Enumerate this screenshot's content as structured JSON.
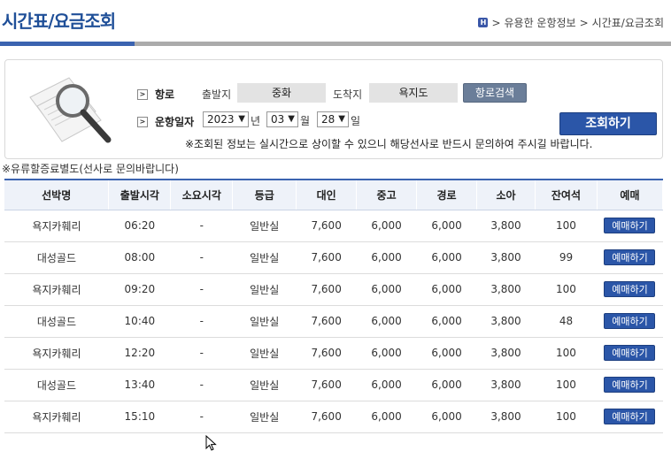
{
  "page_title": "시간표/요금조회",
  "breadcrumb": {
    "home_icon": "home-icon",
    "item1": "유용한 운항정보",
    "sep": ">",
    "item2": "시간표/요금조회"
  },
  "search": {
    "route_label": "항로",
    "departure_label": "출발지",
    "departure_value": "중화",
    "arrival_label": "도착지",
    "arrival_value": "욕지도",
    "route_search_button": "항로검색",
    "date_label": "운항일자",
    "year": "2023",
    "year_unit": "년",
    "month": "03",
    "month_unit": "월",
    "day": "28",
    "day_unit": "일",
    "lookup_button": "조회하기",
    "notice": "※조회된 정보는 실시간으로 상이할 수 있으니 해당선사로 반드시 문의하여 주시길 바랍니다."
  },
  "footnote": "※유류할증료별도(선사로 문의바랍니다)",
  "table": {
    "headers": [
      "선박명",
      "출발시각",
      "소요시각",
      "등급",
      "대인",
      "중고",
      "경로",
      "소아",
      "잔여석",
      "예매"
    ],
    "rows": [
      {
        "ship": "욕지카훼리",
        "time": "06:20",
        "duration": "-",
        "grade": "일반실",
        "adult": "7,600",
        "teen": "6,000",
        "senior": "6,000",
        "child": "3,800",
        "seats": "100",
        "book": "예매하기"
      },
      {
        "ship": "대성골드",
        "time": "08:00",
        "duration": "-",
        "grade": "일반실",
        "adult": "7,600",
        "teen": "6,000",
        "senior": "6,000",
        "child": "3,800",
        "seats": "99",
        "book": "예매하기"
      },
      {
        "ship": "욕지카훼리",
        "time": "09:20",
        "duration": "-",
        "grade": "일반실",
        "adult": "7,600",
        "teen": "6,000",
        "senior": "6,000",
        "child": "3,800",
        "seats": "100",
        "book": "예매하기"
      },
      {
        "ship": "대성골드",
        "time": "10:40",
        "duration": "-",
        "grade": "일반실",
        "adult": "7,600",
        "teen": "6,000",
        "senior": "6,000",
        "child": "3,800",
        "seats": "48",
        "book": "예매하기"
      },
      {
        "ship": "욕지카훼리",
        "time": "12:20",
        "duration": "-",
        "grade": "일반실",
        "adult": "7,600",
        "teen": "6,000",
        "senior": "6,000",
        "child": "3,800",
        "seats": "100",
        "book": "예매하기"
      },
      {
        "ship": "대성골드",
        "time": "13:40",
        "duration": "-",
        "grade": "일반실",
        "adult": "7,600",
        "teen": "6,000",
        "senior": "6,000",
        "child": "3,800",
        "seats": "100",
        "book": "예매하기"
      },
      {
        "ship": "욕지카훼리",
        "time": "15:10",
        "duration": "-",
        "grade": "일반실",
        "adult": "7,600",
        "teen": "6,000",
        "senior": "6,000",
        "child": "3,800",
        "seats": "100",
        "book": "예매하기"
      }
    ]
  },
  "colors": {
    "accent": "#3b63b0",
    "button": "#2b56a8",
    "title": "#1f4f98"
  }
}
